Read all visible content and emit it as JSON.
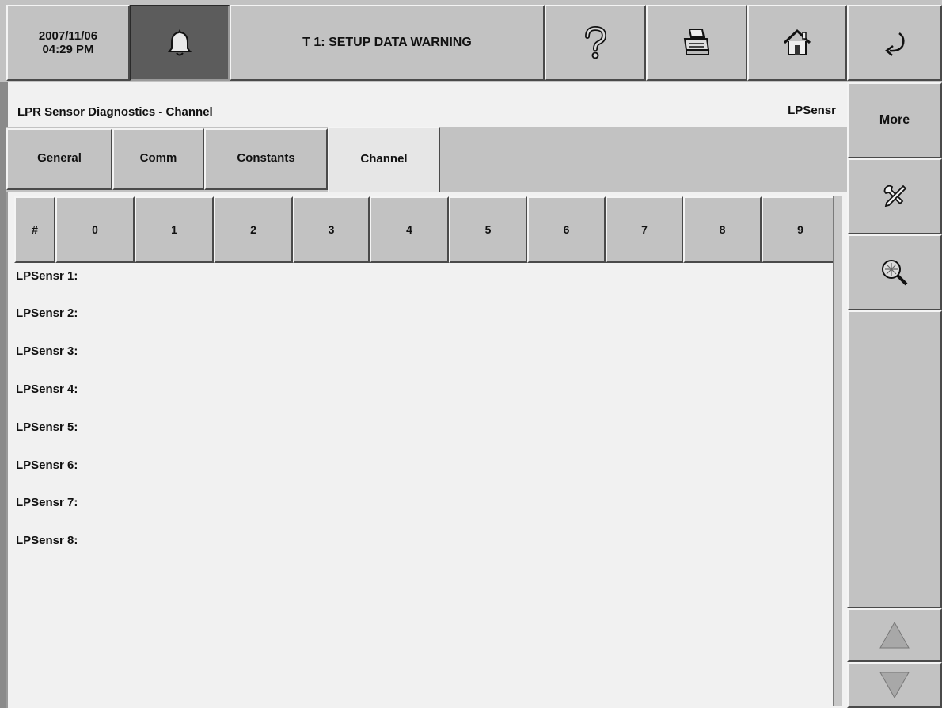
{
  "topbar": {
    "date": "2007/11/06",
    "time": "04:29 PM",
    "warning": "T 1: SETUP DATA WARNING",
    "icons": [
      "bell-icon",
      "help-icon",
      "printer-icon",
      "home-icon",
      "back-arrow-icon"
    ]
  },
  "title": {
    "left": "LPR Sensor Diagnostics - Channel",
    "right": "LPSensr"
  },
  "sidebar": {
    "more_label": "More",
    "icons": [
      "tools-icon",
      "diagnostics-icon",
      "scroll-up-icon",
      "scroll-down-icon"
    ]
  },
  "tabs": [
    {
      "label": "General"
    },
    {
      "label": "Comm"
    },
    {
      "label": "Constants"
    },
    {
      "label": "Channel",
      "active": true
    }
  ],
  "table": {
    "columns": [
      "#",
      "0",
      "1",
      "2",
      "3",
      "4",
      "5",
      "6",
      "7",
      "8",
      "9"
    ],
    "rows": [
      "LPSensr 1:",
      "LPSensr 2:",
      "LPSensr 3:",
      "LPSensr 4:",
      "LPSensr 5:",
      "LPSensr 6:",
      "LPSensr 7:",
      "LPSensr 8:"
    ]
  },
  "colors": {
    "panel": "#c2c2c2",
    "content_bg": "#f1f1f1",
    "alarm_bg": "#5c5c5c"
  }
}
